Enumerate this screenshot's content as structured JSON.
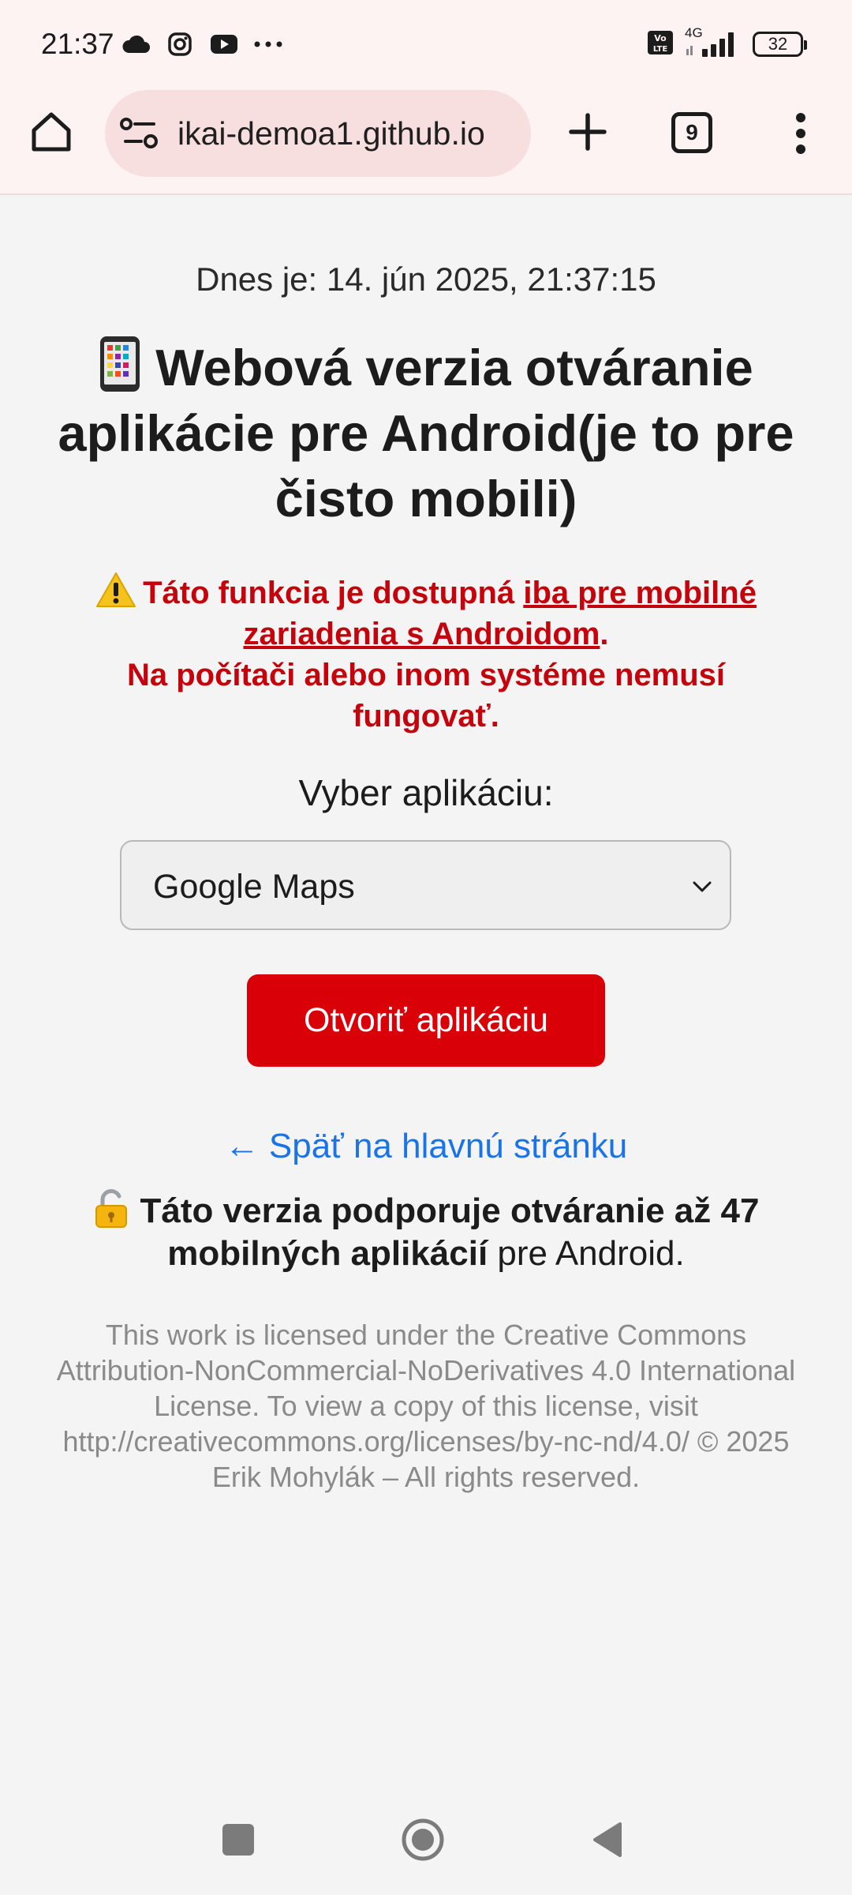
{
  "status_bar": {
    "time": "21:37",
    "battery": "32",
    "icons_left": [
      "cloud-icon",
      "instagram-icon",
      "youtube-icon",
      "more-dots-icon"
    ],
    "icons_right": [
      "volte-icon",
      "signal-4g-icon",
      "battery-icon"
    ],
    "network_label": "4G"
  },
  "browser": {
    "url": "ikai-demoa1.github.io",
    "tab_count": "9",
    "icons": [
      "home-icon",
      "site-settings-icon",
      "plus-icon",
      "more-vert-icon"
    ]
  },
  "page": {
    "date_line": "Dnes je: 14. jún 2025, 21:37:15",
    "title": "Webová verzia otváranie aplikácie pre Android(je to pre čisto mobili)",
    "warning": {
      "prefix": "Táto funkcia je dostupná ",
      "link_text": "iba pre mobilné zariadenia s Androidom",
      "suffix": ".",
      "line2": "Na počítači alebo inom systéme nemusí fungovať."
    },
    "select_label": "Vyber aplikáciu:",
    "selected_app": "Google Maps",
    "open_button": "Otvoriť aplikáciu",
    "back_link": "← Späť na hlavnú stránku",
    "support": {
      "bold": "Táto verzia podporuje otváranie až 47 mobilných aplikácií",
      "rest": " pre Android."
    },
    "license": "This work is licensed under the Creative Commons Attribution-NonCommercial-NoDerivatives 4.0 International License. To view a copy of this license, visit http://creativecommons.org/licenses/by-nc-nd/4.0/ © 2025 Erik Mohylák – All rights reserved."
  },
  "colors": {
    "accent_red": "#d90008",
    "warning_red": "#c4030c",
    "link_blue": "#1a73e8",
    "toolbar_bg": "#fdf3f2",
    "url_pill_bg": "#f6dfde"
  }
}
